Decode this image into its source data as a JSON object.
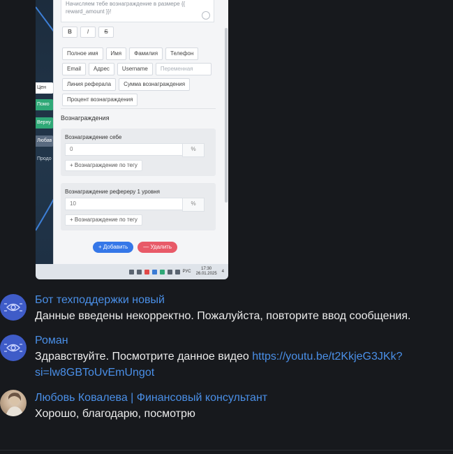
{
  "screenshot": {
    "textarea_text": "Начисляем тебе вознаграждение в размере {{ reward_amount }}!",
    "format_buttons": [
      "B",
      "I",
      "S"
    ],
    "chips": [
      "Полное имя",
      "Имя",
      "Фамилия",
      "Телефон",
      "Email",
      "Адрес",
      "Username"
    ],
    "chip_variable_placeholder": "Переменная",
    "chips_row3": [
      "Линия реферала",
      "Сумма вознаграждения"
    ],
    "chips_row4": [
      "Процент вознаграждения"
    ],
    "side_tabs": [
      "Цен",
      "Помо",
      "Верну",
      "Любав",
      "Продо"
    ],
    "rewards_title": "Вознаграждения",
    "reward_self": {
      "title": "Вознаграждение себе",
      "value": "0",
      "unit": "%",
      "tag_button": "+ Вознаграждение по тегу"
    },
    "reward_referrer": {
      "title": "Вознаграждение рефереру 1 уровня",
      "value": "10",
      "unit": "%",
      "tag_button": "+ Вознаграждение по тегу"
    },
    "add_button": "+ Добавить",
    "delete_button": "— Удалить",
    "taskbar": {
      "lang": "РУС",
      "time": "17:30",
      "date": "26.01.2025",
      "notif_count": "4"
    }
  },
  "messages": [
    {
      "author": "Бот техподдержки новый",
      "text": "Данные введены некорректно. Пожалуйста, повторите ввод сообщения.",
      "avatar_icon": "bot-icon"
    },
    {
      "author": "Роман",
      "text": "Здравствуйте. Посмотрите данное видео ",
      "link": "https://youtu.be/t2KkjeG3JKk?si=lw8GBToUvEmUngot",
      "avatar_icon": "bot-icon"
    },
    {
      "author": "Любовь Ковалева | Финансовый консультант",
      "text": "Хорошо, благодарю, посмотрю",
      "avatar_icon": "user-photo"
    }
  ],
  "colors": {
    "background": "#17191d",
    "author": "#4a8fe7",
    "link": "#4a8fe7",
    "avatar_bot": "#3f5cc8"
  }
}
